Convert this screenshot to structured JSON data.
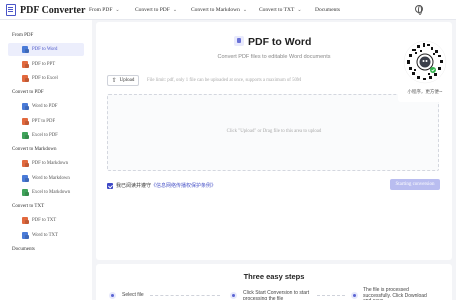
{
  "header": {
    "logo_text": "PDF Converter",
    "nav": [
      {
        "label": "From PDF",
        "has_dropdown": true
      },
      {
        "label": "Convert to PDF",
        "has_dropdown": true
      },
      {
        "label": "Convert to Markdown",
        "has_dropdown": true
      },
      {
        "label": "Convert to TXT",
        "has_dropdown": true
      },
      {
        "label": "Documents",
        "has_dropdown": false
      }
    ],
    "language_icon": "globe-icon"
  },
  "sidebar": {
    "groups": [
      {
        "label": "From PDF",
        "items": [
          {
            "label": "PDF to Word",
            "active": true,
            "icon_color": "#4a7bd8"
          },
          {
            "label": "PDF to PPT",
            "active": false,
            "icon_color": "#e2693e"
          },
          {
            "label": "PDF to Excel",
            "active": false,
            "icon_color": "#e2693e"
          }
        ]
      },
      {
        "label": "Convert to PDF",
        "items": [
          {
            "label": "Word to PDF",
            "active": false,
            "icon_color": "#4a7bd8"
          },
          {
            "label": "PPT to PDF",
            "active": false,
            "icon_color": "#e2693e"
          },
          {
            "label": "Excel to PDF",
            "active": false,
            "icon_color": "#3fa35a"
          }
        ]
      },
      {
        "label": "Convert to Markdown",
        "items": [
          {
            "label": "PDF to Markdown",
            "active": false,
            "icon_color": "#e2693e"
          },
          {
            "label": "Word to Markdown",
            "active": false,
            "icon_color": "#4a7bd8"
          },
          {
            "label": "Excel to Markdown",
            "active": false,
            "icon_color": "#3fa35a"
          }
        ]
      },
      {
        "label": "Convert to TXT",
        "items": [
          {
            "label": "PDF to TXT",
            "active": false,
            "icon_color": "#e2693e"
          },
          {
            "label": "Word to TXT",
            "active": false,
            "icon_color": "#4a7bd8"
          }
        ]
      },
      {
        "label": "Documents",
        "items": []
      }
    ]
  },
  "main": {
    "title": "PDF to Word",
    "subtitle": "Convert PDF files to editable Word documents",
    "upload_label": "Upload",
    "upload_hint": "File limit: pdf, only 1 file can be uploaded at once, supports a maximum of 50M",
    "drop_hint": "Click \"Upload\" or Drag file to this area to upload",
    "agree_text": "我已阅读并遵守",
    "agree_link": "《信息网络传播权保护条例》",
    "agree_checked": true,
    "convert_label": "Starting conversion"
  },
  "steps": {
    "title": "Three easy steps",
    "items": [
      {
        "text": "Select file"
      },
      {
        "text": "Click Start Conversion to start processing the file"
      },
      {
        "text": "The file is processed successfully. Click Download and save"
      }
    ]
  },
  "qr": {
    "label": "小程序，更方便~"
  },
  "colors": {
    "accent": "#4a55c8",
    "active_bg": "#eceefc",
    "disabled_button": "#b9bdf0",
    "page_bg": "#f3f4f7"
  }
}
